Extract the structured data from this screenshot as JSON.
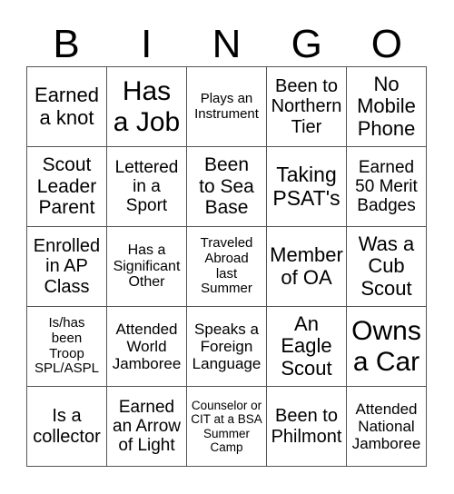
{
  "header": {
    "letters": [
      "B",
      "I",
      "N",
      "G",
      "O"
    ]
  },
  "cells": [
    [
      "Earned\na knot",
      "Has\na Job",
      "Plays an\nInstrument",
      "Been to\nNorthern\nTier",
      "No\nMobile\nPhone"
    ],
    [
      "Scout\nLeader\nParent",
      "Lettered\nin a\nSport",
      "Been\nto Sea\nBase",
      "Taking\nPSAT's",
      "Earned\n50 Merit\nBadges"
    ],
    [
      "Enrolled\nin AP\nClass",
      "Has a\nSignificant\nOther",
      "Traveled\nAbroad\nlast\nSummer",
      "Member\nof OA",
      "Was a\nCub\nScout"
    ],
    [
      "Is/has\nbeen\nTroop\nSPL/ASPL",
      "Attended\nWorld\nJamboree",
      "Speaks a\nForeign\nLanguage",
      "An\nEagle\nScout",
      "Owns\na Car"
    ],
    [
      "Is a\ncollector",
      "Earned\nan Arrow\nof Light",
      "Counselor or\nCIT at a BSA\nSummer\nCamp",
      "Been to\nPhilmont",
      "Attended\nNational\nJamboree"
    ]
  ]
}
